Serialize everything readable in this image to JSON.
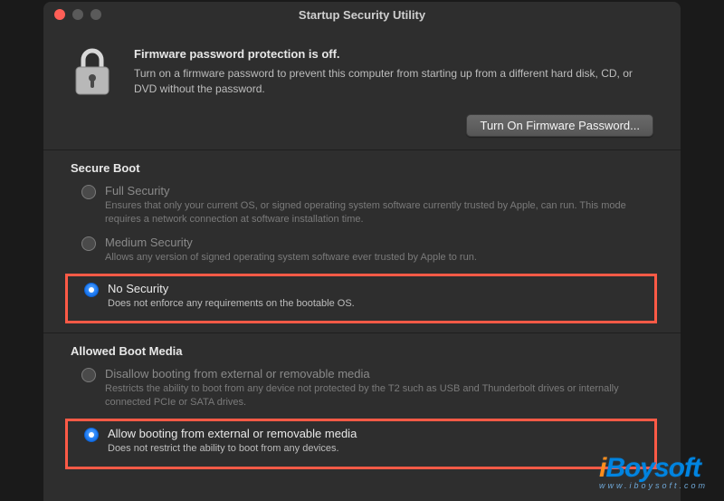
{
  "window": {
    "title": "Startup Security Utility"
  },
  "firmware": {
    "heading": "Firmware password protection is off.",
    "description": "Turn on a firmware password to prevent this computer from starting up from a different hard disk, CD, or DVD without the password.",
    "button": "Turn On Firmware Password..."
  },
  "secure_boot": {
    "title": "Secure Boot",
    "options": [
      {
        "label": "Full Security",
        "desc": "Ensures that only your current OS, or signed operating system software currently trusted by Apple, can run. This mode requires a network connection at software installation time.",
        "selected": false
      },
      {
        "label": "Medium Security",
        "desc": "Allows any version of signed operating system software ever trusted by Apple to run.",
        "selected": false
      },
      {
        "label": "No Security",
        "desc": "Does not enforce any requirements on the bootable OS.",
        "selected": true
      }
    ]
  },
  "boot_media": {
    "title": "Allowed Boot Media",
    "options": [
      {
        "label": "Disallow booting from external or removable media",
        "desc": "Restricts the ability to boot from any device not protected by the T2 such as USB and Thunderbolt drives or internally connected PCIe or SATA drives.",
        "selected": false
      },
      {
        "label": "Allow booting from external or removable media",
        "desc": "Does not restrict the ability to boot from any devices.",
        "selected": true
      }
    ]
  },
  "watermark": {
    "brand": "iBoysoft",
    "sub": "www.iboysoft.com"
  }
}
